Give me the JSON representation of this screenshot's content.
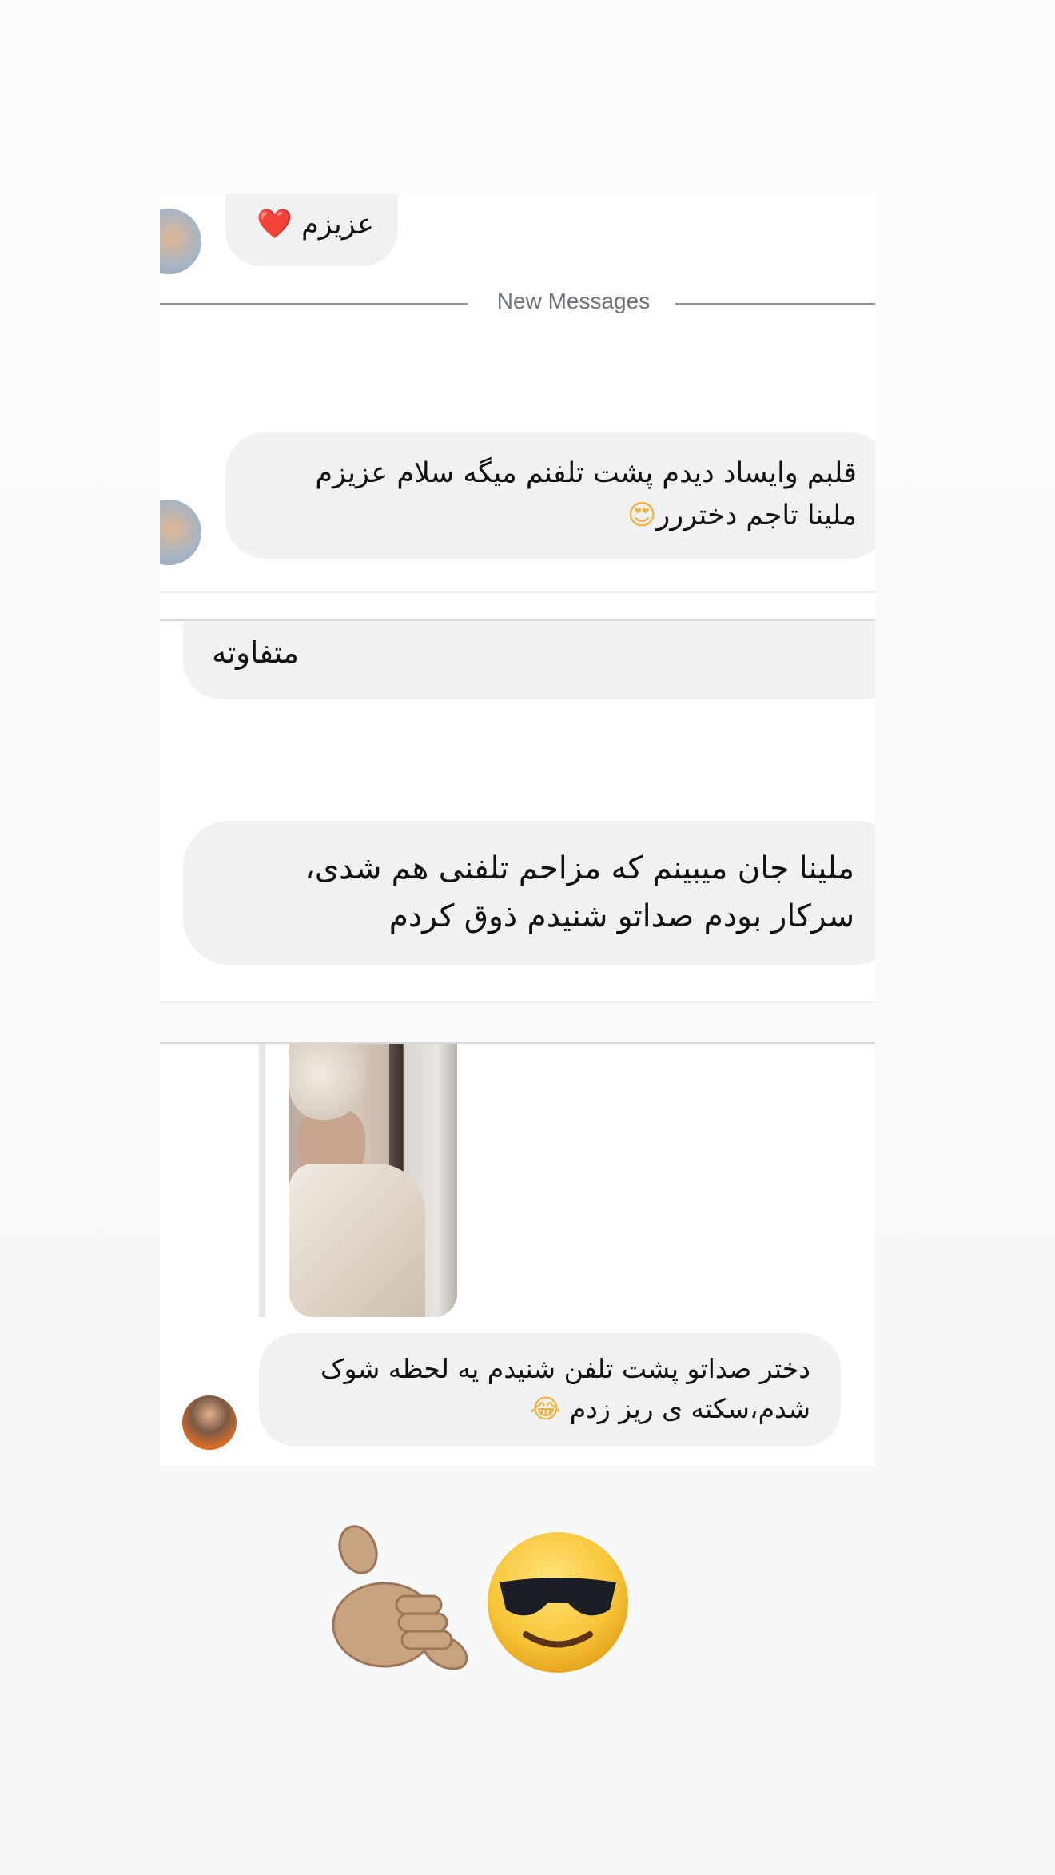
{
  "thread1": {
    "message_1": {
      "text": "عزیزم",
      "emoji": "❤️"
    },
    "divider_label": "New Messages",
    "message_2": {
      "line_1": "قلبم وایساد دیدم پشت تلفنم میگه سلام عزیزم",
      "line_2": "ملینا تاجم دختررر",
      "emoji": "😍"
    }
  },
  "thread2": {
    "message_3": {
      "text": "متفاوته"
    },
    "message_4": {
      "line_1": "ملینا جان میبینم که مزاحم تلفنی هم شدی،",
      "line_2": "سرکار بودم صداتو شنیدم ذوق کردم"
    }
  },
  "thread3": {
    "message_5": {
      "line_1": "دختر صداتو پشت تلفن شنیدم یه لحظه شوک",
      "line_2": "شدم،سکته ی ریز زدم",
      "emoji": "😂"
    }
  },
  "story_stickers": {
    "call_me_icon_name": "call-me-hand-emoji",
    "cool_face_icon_name": "sunglasses-smile-emoji"
  }
}
